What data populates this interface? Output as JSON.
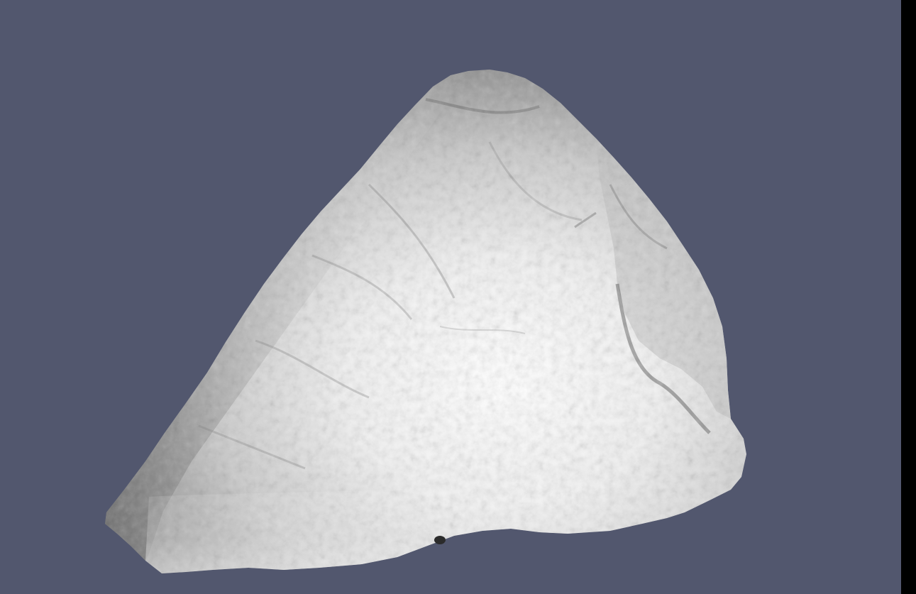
{
  "viewport": {
    "background_color": "#52576e",
    "edge_strip_color": "#000000"
  },
  "mesh": {
    "icon": "rock-mesh-icon",
    "base_color": "#e6e6e6",
    "shadow_color": "#5a5a5a",
    "highlight_color": "#ffffff"
  }
}
